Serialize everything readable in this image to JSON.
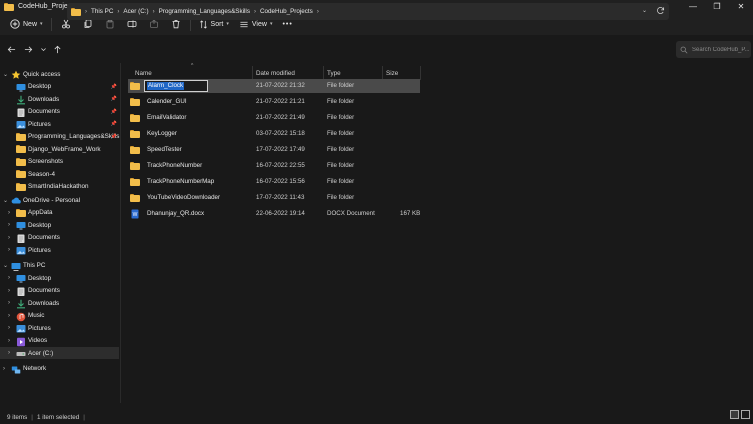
{
  "window": {
    "title": "CodeHub_Projects",
    "controls": {
      "minimize": "—",
      "maximize": "❐",
      "close": "✕"
    }
  },
  "toolbar": {
    "new_label": "New",
    "sort_label": "Sort",
    "view_label": "View",
    "more_label": "•••",
    "icons": [
      "plus-icon",
      "cut-icon",
      "copy-icon",
      "paste-icon",
      "rename-icon",
      "share-icon",
      "delete-icon",
      "sort-icon",
      "view-icon",
      "more-icon"
    ]
  },
  "address": {
    "crumbs": [
      "This PC",
      "Acer (C:)",
      "Programming_Languages&Skills",
      "CodeHub_Projects"
    ],
    "search_placeholder": "Search CodeHub_P..."
  },
  "sidebar": {
    "quick_access": {
      "label": "Quick access",
      "items": [
        {
          "label": "Desktop",
          "icon": "desktop-icon",
          "pinned": true
        },
        {
          "label": "Downloads",
          "icon": "downloads-icon",
          "pinned": true
        },
        {
          "label": "Documents",
          "icon": "documents-icon",
          "pinned": true
        },
        {
          "label": "Pictures",
          "icon": "pictures-icon",
          "pinned": true
        },
        {
          "label": "Programming_Languages&Skills",
          "icon": "folder-icon",
          "pinned": true
        },
        {
          "label": "Django_WebFrame_Work",
          "icon": "folder-icon",
          "pinned": false
        },
        {
          "label": "Screenshots",
          "icon": "folder-icon",
          "pinned": false
        },
        {
          "label": "Season-4",
          "icon": "folder-icon",
          "pinned": false
        },
        {
          "label": "SmartIndiaHackathon",
          "icon": "folder-icon",
          "pinned": false
        }
      ]
    },
    "onedrive": {
      "label": "OneDrive - Personal",
      "items": [
        {
          "label": "AppData",
          "icon": "folder-icon"
        },
        {
          "label": "Desktop",
          "icon": "desktop-icon"
        },
        {
          "label": "Documents",
          "icon": "documents-icon"
        },
        {
          "label": "Pictures",
          "icon": "pictures-icon"
        }
      ]
    },
    "this_pc": {
      "label": "This PC",
      "items": [
        {
          "label": "Desktop",
          "icon": "desktop-icon"
        },
        {
          "label": "Documents",
          "icon": "documents-icon"
        },
        {
          "label": "Downloads",
          "icon": "downloads-icon"
        },
        {
          "label": "Music",
          "icon": "music-icon"
        },
        {
          "label": "Pictures",
          "icon": "pictures-icon"
        },
        {
          "label": "Videos",
          "icon": "videos-icon"
        },
        {
          "label": "Acer (C:)",
          "icon": "drive-icon"
        }
      ]
    },
    "network": {
      "label": "Network"
    }
  },
  "columns": {
    "name": "Name",
    "date": "Date modified",
    "type": "Type",
    "size": "Size"
  },
  "files": [
    {
      "name": "Alarm_Clock",
      "date": "21-07-2022 21:32",
      "type": "File folder",
      "size": "",
      "kind": "folder",
      "selected": true,
      "renaming": true
    },
    {
      "name": "Calender_GUI",
      "date": "21-07-2022 21:21",
      "type": "File folder",
      "size": "",
      "kind": "folder"
    },
    {
      "name": "EmailValidator",
      "date": "21-07-2022 21:49",
      "type": "File folder",
      "size": "",
      "kind": "folder"
    },
    {
      "name": "KeyLogger",
      "date": "03-07-2022 15:18",
      "type": "File folder",
      "size": "",
      "kind": "folder"
    },
    {
      "name": "SpeedTester",
      "date": "17-07-2022 17:49",
      "type": "File folder",
      "size": "",
      "kind": "folder"
    },
    {
      "name": "TrackPhoneNumber",
      "date": "16-07-2022 22:55",
      "type": "File folder",
      "size": "",
      "kind": "folder"
    },
    {
      "name": "TrackPhoneNumberMap",
      "date": "16-07-2022 15:56",
      "type": "File folder",
      "size": "",
      "kind": "folder"
    },
    {
      "name": "YouTubeVideoDownloader",
      "date": "17-07-2022 11:43",
      "type": "File folder",
      "size": "",
      "kind": "folder"
    },
    {
      "name": "Dhanunjay_QR.docx",
      "date": "22-06-2022 19:14",
      "type": "DOCX Document",
      "size": "167 KB",
      "kind": "docx"
    }
  ],
  "status": {
    "items": "9 items",
    "selected": "1 item selected"
  },
  "colors": {
    "folder": "#f2bd4a",
    "selection": "#4a4a4a",
    "rename_highlight": "#1f66c6",
    "background": "#191919"
  }
}
